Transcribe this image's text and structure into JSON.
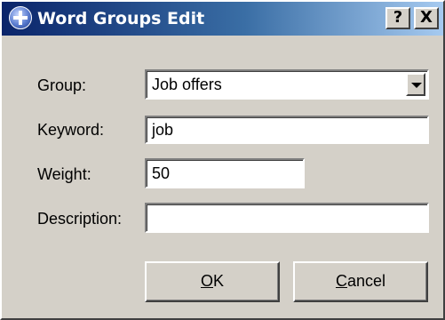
{
  "window": {
    "title": "Word Groups Edit",
    "help_label": "?",
    "close_label": "X"
  },
  "form": {
    "group": {
      "label": "Group:",
      "value": "Job offers"
    },
    "keyword": {
      "label": "Keyword:",
      "value": "job"
    },
    "weight": {
      "label": "Weight:",
      "value": "50"
    },
    "description": {
      "label": "Description:",
      "value": ""
    }
  },
  "buttons": {
    "ok": {
      "label": "OK",
      "mnemonic": "O",
      "rest": "K"
    },
    "cancel": {
      "label": "Cancel",
      "mnemonic": "C",
      "rest": "ancel"
    }
  },
  "colors": {
    "titlebar_start": "#0a246a",
    "titlebar_end": "#a6caf0",
    "face": "#d4d0c8"
  }
}
